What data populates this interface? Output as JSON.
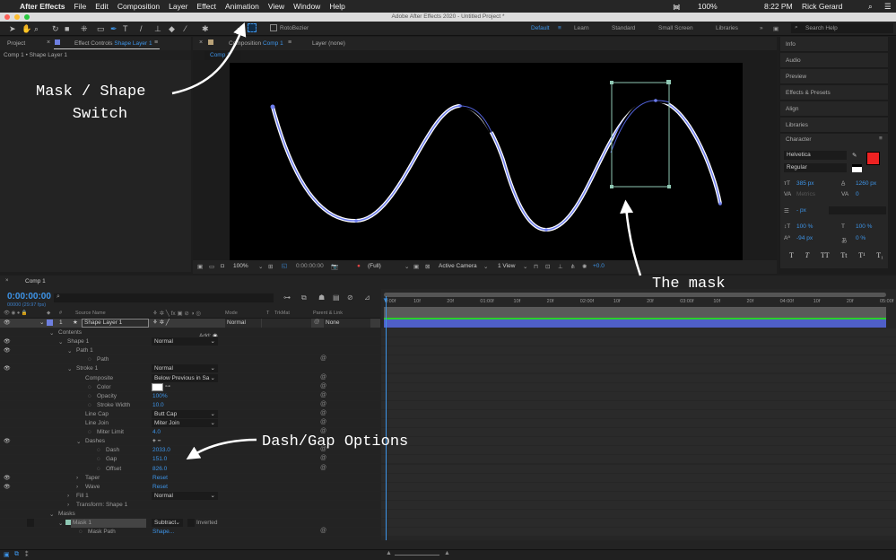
{
  "menubar": {
    "apple": "",
    "app": "After Effects",
    "items": [
      "File",
      "Edit",
      "Composition",
      "Layer",
      "Effect",
      "Animation",
      "View",
      "Window",
      "Help"
    ],
    "battery": "100%",
    "time": "8:22 PM",
    "user": "Rick Gerard"
  },
  "window": {
    "title": "Adobe After Effects 2020 - Untitled Project *"
  },
  "toolbar": {
    "roto_label": "RotoBezier",
    "workspaces": [
      "Default",
      "Learn",
      "Standard",
      "Small Screen",
      "Libraries"
    ],
    "active_workspace": "Default",
    "search_placeholder": "Search Help"
  },
  "left_panel": {
    "tab_project": "Project",
    "tab_effect_prefix": "Effect Controls",
    "tab_effect_layer": "Shape Layer 1",
    "breadcrumb": "Comp 1 • Shape Layer 1"
  },
  "comp_panel": {
    "tab_prefix": "Composition",
    "tab_comp": "Comp 1",
    "tab_layer": "Layer (none)",
    "subtab": "Comp 1"
  },
  "viewer": {
    "zoom": "100%",
    "timecode": "0:00:00:00",
    "resolution": "(Full)",
    "camera": "Active Camera",
    "views": "1 View",
    "exposure": "+0.0",
    "path_color": "#6f7ff0",
    "mask_color": "#8fc8b4"
  },
  "right_panel": {
    "items": [
      "Info",
      "Audio",
      "Preview",
      "Effects & Presets",
      "Align",
      "Libraries"
    ],
    "character": {
      "title": "Character",
      "font": "Helvetica",
      "style": "Regular",
      "size": "385 px",
      "leading": "1260 px",
      "kerning": "Metrics",
      "tracking": "0",
      "stroke": "- px",
      "vscale": "100 %",
      "hscale": "100 %",
      "baseline": "-94 px",
      "tsume": "0 %",
      "fill_color": "#ee2222",
      "styles": [
        "T",
        "T",
        "TT",
        "Tt",
        "T¹",
        "T₁"
      ]
    }
  },
  "timeline": {
    "tab": "Comp 1",
    "timecode": "0:00:00:00",
    "frames": "00000 (29.97 fps)",
    "headers": {
      "source": "Source Name",
      "mode": "Mode",
      "t": "T",
      "trkmat": "TrkMat",
      "parent": "Parent & Link"
    },
    "layer": {
      "number": "1",
      "name": "Shape Layer 1",
      "mode": "Normal",
      "parent": "None",
      "color": "#6e7fe0"
    },
    "add_label": "Add:",
    "rows": [
      {
        "level": 1,
        "twirl": "open",
        "label": "Contents",
        "eye": false
      },
      {
        "level": 2,
        "twirl": "open",
        "label": "Shape 1",
        "eye": true,
        "dropdown": "Normal"
      },
      {
        "level": 3,
        "twirl": "open",
        "label": "Path 1",
        "eye": true
      },
      {
        "level": 4,
        "stopwatch": true,
        "label": "Path",
        "link": true
      },
      {
        "level": 3,
        "twirl": "open",
        "label": "Stroke 1",
        "eye": true,
        "dropdown": "Normal"
      },
      {
        "level": 4,
        "label": "Composite",
        "dropdown": "Below Previous in Sa",
        "link": true
      },
      {
        "level": 4,
        "stopwatch": true,
        "label": "Color",
        "swatch": "#ffffff",
        "link": true
      },
      {
        "level": 4,
        "stopwatch": true,
        "label": "Opacity",
        "value": "100%",
        "link": true
      },
      {
        "level": 4,
        "stopwatch": true,
        "label": "Stroke Width",
        "value": "10.0",
        "link": true
      },
      {
        "level": 4,
        "label": "Line Cap",
        "dropdown": "Butt Cap",
        "link": true
      },
      {
        "level": 4,
        "label": "Line Join",
        "dropdown": "Miter Join",
        "link": true
      },
      {
        "level": 4,
        "stopwatch": true,
        "label": "Miter Limit",
        "value": "4.0",
        "link": true
      },
      {
        "level": 4,
        "twirl": "open",
        "label": "Dashes",
        "eye": true,
        "plain": "+ −"
      },
      {
        "level": 5,
        "stopwatch": true,
        "label": "Dash",
        "value": "2033.0",
        "link": true
      },
      {
        "level": 5,
        "stopwatch": true,
        "label": "Gap",
        "value": "151.0",
        "link": true
      },
      {
        "level": 5,
        "stopwatch": true,
        "label": "Offset",
        "value": "826.0",
        "link": true
      },
      {
        "level": 4,
        "twirl": "closed",
        "label": "Taper",
        "eye": true,
        "value": "Reset"
      },
      {
        "level": 4,
        "twirl": "closed",
        "label": "Wave",
        "eye": true,
        "value": "Reset"
      },
      {
        "level": 3,
        "twirl": "closed",
        "label": "Fill 1",
        "dropdown": "Normal"
      },
      {
        "level": 3,
        "twirl": "closed",
        "label": "Transform: Shape 1"
      },
      {
        "level": 1,
        "twirl": "open",
        "label": "Masks"
      },
      {
        "level": 2,
        "twirl": "open",
        "label": "Mask 1",
        "mask": true,
        "dropdown": "Subtract",
        "inverted": "Inverted"
      },
      {
        "level": 3,
        "stopwatch": true,
        "label": "Mask Path",
        "value": "Shape...",
        "link": true
      }
    ],
    "ruler": [
      "0:00f",
      "10f",
      "20f",
      "01:00f",
      "10f",
      "20f",
      "02:00f",
      "10f",
      "20f",
      "03:00f",
      "10f",
      "20f",
      "04:00f",
      "10f",
      "20f",
      "05:00f"
    ]
  },
  "annotations": {
    "switch": "Mask / Shape\n    Switch",
    "mask": "The mask",
    "dash": "Dash/Gap Options"
  }
}
